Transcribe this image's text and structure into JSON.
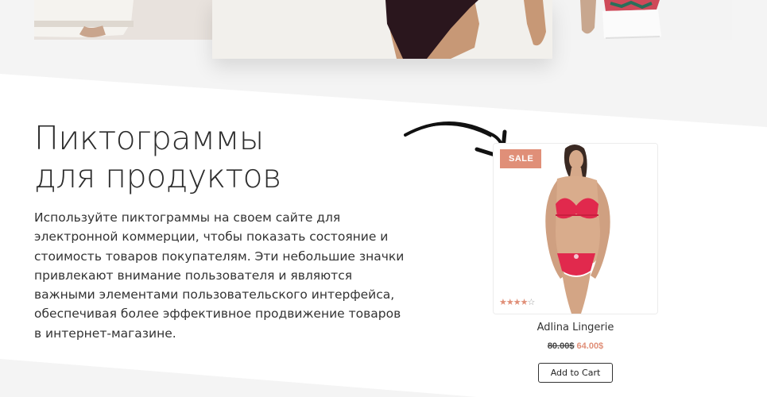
{
  "headline": {
    "line1": "Пиктограммы",
    "line2": "для продуктов"
  },
  "description": "Используйте пиктограммы на своем сайте для электронной коммерции, чтобы показать состояние и стоимость товаров покупателям. Эти небольшие значки привлекают внимание пользователя и являются важными элементами пользовательского интерфейса, обеспечивая более эффективное продвижение товаров в интернет-магазине.",
  "product": {
    "badge": "SALE",
    "name": "Adlina Lingerie",
    "price_old": "80.00$",
    "price_new": "64.00$",
    "rating": 4,
    "rating_max": 5,
    "add_to_cart": "Add to Cart"
  },
  "colors": {
    "accent": "#e08f78",
    "background_gray": "#f4f4f4",
    "text_dark": "#2c2c2c"
  }
}
